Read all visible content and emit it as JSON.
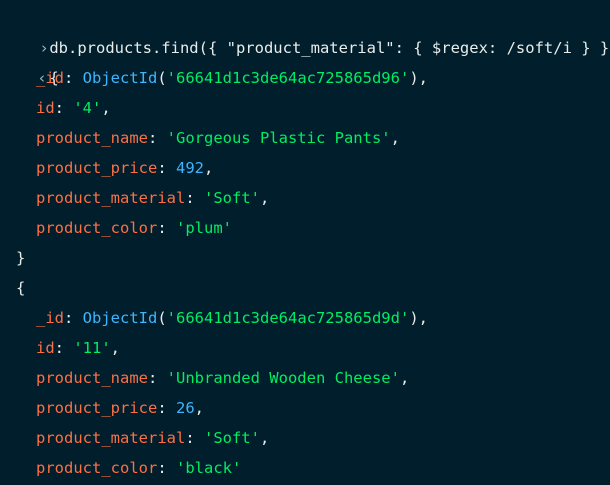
{
  "command": "db.products.find({ \"product_material\": { $regex: /soft/i } })",
  "prompt_icon": "chevron-right-icon",
  "output_icon": "chevron-left-icon",
  "doc_open": "{",
  "doc_close": "}",
  "documents": [
    {
      "_id_key": "_id",
      "_id_fn": "ObjectId",
      "_id_value": "'66641d1c3de64ac725865d96'",
      "id_key": "id",
      "id_value": "'4'",
      "name_key": "product_name",
      "name_value": "'Gorgeous Plastic Pants'",
      "price_key": "product_price",
      "price_value": "492",
      "material_key": "product_material",
      "material_value": "'Soft'",
      "color_key": "product_color",
      "color_value": "'plum'"
    },
    {
      "_id_key": "_id",
      "_id_fn": "ObjectId",
      "_id_value": "'66641d1c3de64ac725865d9d'",
      "id_key": "id",
      "id_value": "'11'",
      "name_key": "product_name",
      "name_value": "'Unbranded Wooden Cheese'",
      "price_key": "product_price",
      "price_value": "26",
      "material_key": "product_material",
      "material_value": "'Soft'",
      "color_key": "product_color",
      "color_value": "'black'"
    }
  ],
  "colors": {
    "background": "#001e2b",
    "key": "#ff6f44",
    "string": "#00ed64",
    "number": "#3eb6ff"
  }
}
